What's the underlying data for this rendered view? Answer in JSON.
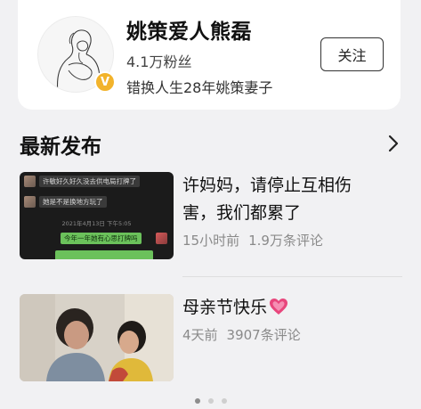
{
  "profile": {
    "name": "姚策爱人熊磊",
    "fans": "4.1万粉丝",
    "description": "错换人生28年姚策妻子",
    "follow_label": "关注",
    "verified_mark": "V",
    "badge_color": "#f2b32b"
  },
  "section": {
    "title": "最新发布"
  },
  "posts": [
    {
      "title": "许妈妈，请停止互相伤害，我们都累了",
      "time": "15小时前",
      "comments": "1.9万条评论",
      "thumbnail": {
        "type": "chat-screenshot",
        "messages": [
          {
            "side": "left",
            "text": "许敏好久好久没去供电局打牌了"
          },
          {
            "side": "left",
            "text": "她是不是换地方玩了"
          },
          {
            "side": "right",
            "text": "今年一年她有心思打牌吗"
          }
        ],
        "timestamp": "2021年4月13日 下午5:05"
      }
    },
    {
      "title": "母亲节快乐",
      "emoji": "heart-icon",
      "time": "4天前",
      "comments": "3907条评论",
      "thumbnail": {
        "type": "photo"
      }
    }
  ],
  "pagination": {
    "pages": 3,
    "active": 1
  },
  "colors": {
    "background": "#f1f1f3",
    "card": "#ffffff",
    "meta_text": "#8a8a8a",
    "heart": "#e8467c"
  }
}
